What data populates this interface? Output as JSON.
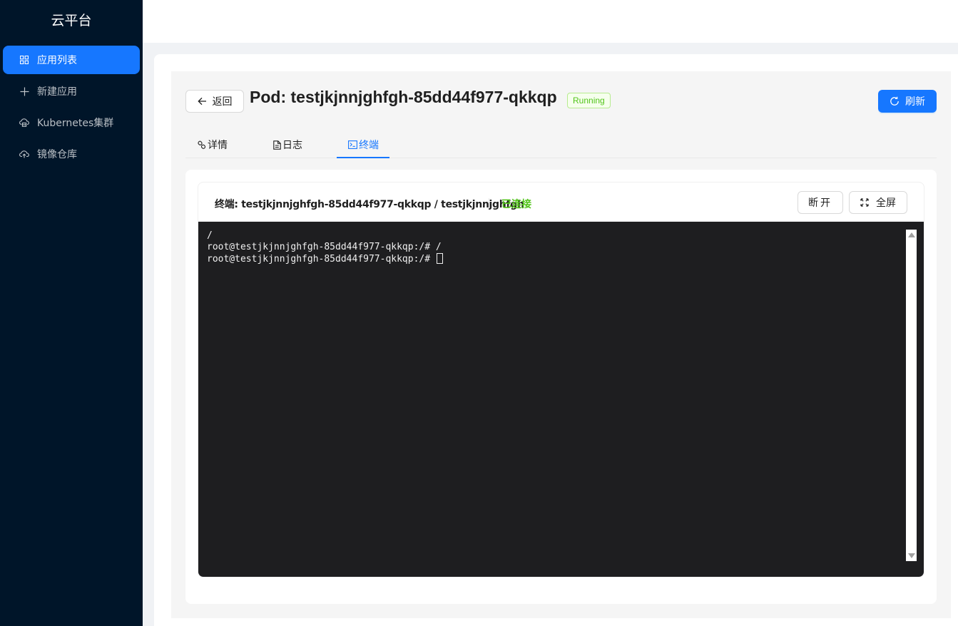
{
  "sidebar": {
    "logo": "云平台",
    "items": [
      {
        "label": "应用列表",
        "icon": "appstore-icon",
        "active": true
      },
      {
        "label": "新建应用",
        "icon": "plus-icon",
        "active": false
      },
      {
        "label": "Kubernetes集群",
        "icon": "cloud-server-icon",
        "active": false
      },
      {
        "label": "镜像仓库",
        "icon": "cloud-upload-icon",
        "active": false
      }
    ]
  },
  "page": {
    "back_label": "返回",
    "title": "Pod: testjkjnnjghfgh-85dd44f977-qkkqp",
    "status": "Running",
    "refresh_label": "刷新"
  },
  "tabs": [
    {
      "label": "详情",
      "icon": "link-icon"
    },
    {
      "label": "日志",
      "icon": "file-text-icon"
    },
    {
      "label": "终端",
      "icon": "code-icon",
      "active": true
    }
  ],
  "terminal": {
    "title": "终端: testjkjnnjghfgh-85dd44f977-qkkqp / testjkjnnjghfgh",
    "status": "已连接",
    "disconnect_label": "断开",
    "fullscreen_label": "全屏",
    "lines": [
      "/",
      "root@testjkjnnjghfgh-85dd44f977-qkkqp:/# /",
      "root@testjkjnnjghfgh-85dd44f977-qkkqp:/# "
    ]
  },
  "colors": {
    "sidebar_bg": "#001529",
    "accent": "#1677ff",
    "success": "#52c41a",
    "terminal_bg": "#1e1e20"
  }
}
